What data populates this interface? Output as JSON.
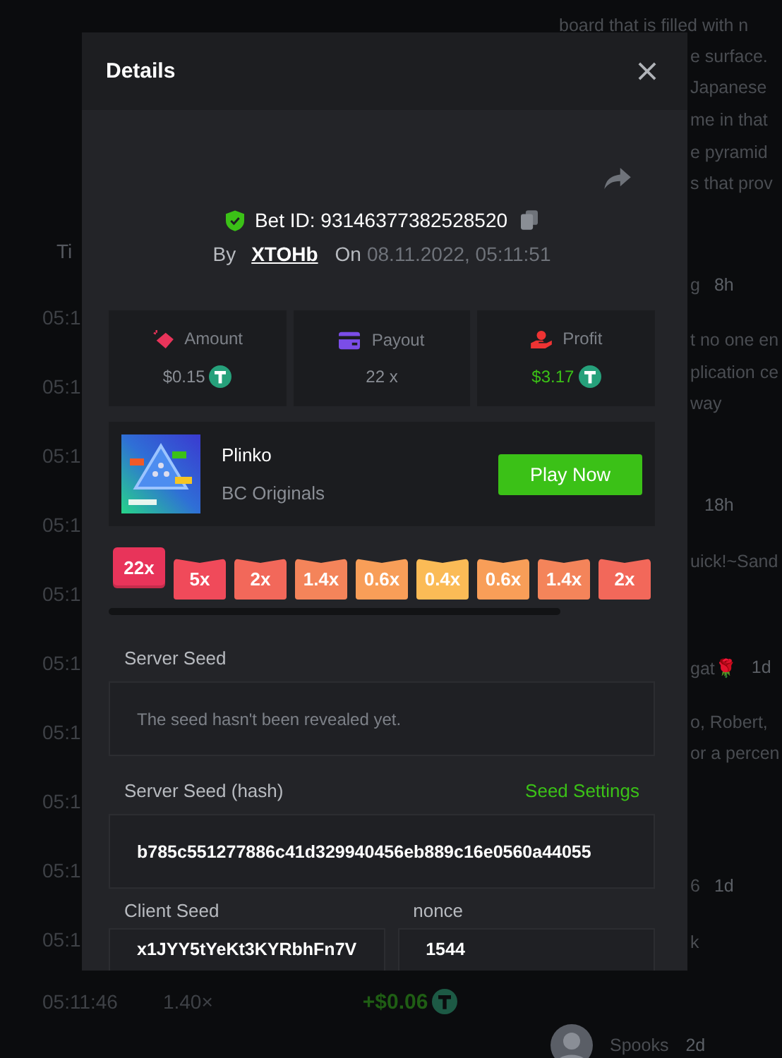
{
  "background": {
    "table": {
      "header": "Ti",
      "rows": [
        {
          "time": "05:1"
        },
        {
          "time": "05:1"
        },
        {
          "time": "05:1"
        },
        {
          "time": "05:1"
        },
        {
          "time": "05:1"
        },
        {
          "time": "05:1"
        },
        {
          "time": "05:1"
        },
        {
          "time": "05:1"
        },
        {
          "time": "05:1"
        },
        {
          "time": "05:1"
        }
      ],
      "last_row": {
        "time": "05:11:46",
        "payout": "1.40×",
        "profit": "+$0.06"
      }
    },
    "chat": {
      "lines": [
        {
          "kind": "full",
          "text": "board that is filled with n"
        },
        {
          "kind": "cut",
          "text": "e surface."
        },
        {
          "kind": "cut",
          "text": "Japanese"
        },
        {
          "kind": "cut",
          "text": "me in that"
        },
        {
          "kind": "cut",
          "text": "e pyramid"
        },
        {
          "kind": "cut",
          "text": "s that prov"
        },
        {
          "kind": "meta",
          "text": "g",
          "age": "8h"
        },
        {
          "kind": "cut",
          "text": "t no one en"
        },
        {
          "kind": "cut",
          "text": "plication ce"
        },
        {
          "kind": "cut",
          "text": "way"
        },
        {
          "kind": "meta",
          "age": "18h"
        },
        {
          "kind": "cut",
          "text": "uick!~Sand"
        },
        {
          "kind": "meta",
          "text": "gat🌹",
          "age": "1d"
        },
        {
          "kind": "cut",
          "text": "o, Robert,"
        },
        {
          "kind": "cut",
          "text": "or a percen"
        },
        {
          "kind": "meta",
          "text": "6",
          "age": "1d"
        },
        {
          "kind": "cut",
          "text": "k"
        }
      ],
      "user": {
        "name": "Spooks",
        "age": "2d"
      }
    }
  },
  "modal": {
    "title": "Details",
    "bet": {
      "id_label": "Bet ID: 93146377382528520",
      "by_label": "By",
      "user": "XTOHb",
      "on_label": "On",
      "date": "08.11.2022, 05:11:51"
    },
    "stats": [
      {
        "kind": "amount",
        "label": "Amount",
        "value": "$0.15",
        "coin": true,
        "positive": false
      },
      {
        "kind": "payout",
        "label": "Payout",
        "value": "22 x",
        "coin": false,
        "positive": false
      },
      {
        "kind": "profit",
        "label": "Profit",
        "value": "$3.17",
        "coin": true,
        "positive": true
      }
    ],
    "game": {
      "name": "Plinko",
      "provider": "BC Originals",
      "button": "Play Now"
    },
    "multipliers": [
      {
        "label": "22x",
        "color": "#e8345a",
        "selected": true
      },
      {
        "label": "5x",
        "color": "#f04a5a",
        "selected": false
      },
      {
        "label": "2x",
        "color": "#f2685a",
        "selected": false
      },
      {
        "label": "1.4x",
        "color": "#f4845a",
        "selected": false
      },
      {
        "label": "0.6x",
        "color": "#f89e58",
        "selected": false
      },
      {
        "label": "0.4x",
        "color": "#fbbb56",
        "selected": false
      },
      {
        "label": "0.6x",
        "color": "#f89e58",
        "selected": false
      },
      {
        "label": "1.4x",
        "color": "#f4845a",
        "selected": false
      },
      {
        "label": "2x",
        "color": "#f2685a",
        "selected": false
      }
    ],
    "server_seed": {
      "label": "Server Seed",
      "note": "The seed hasn't been revealed yet."
    },
    "server_seed_hash": {
      "label": "Server Seed (hash)",
      "link": "Seed Settings",
      "value": "b785c551277886c41d329940456eb889c16e0560a44055"
    },
    "client_seed": {
      "label": "Client Seed",
      "value": "x1JYY5tYeKt3KYRbhFn7V"
    },
    "nonce": {
      "label": "nonce",
      "value": "1544"
    }
  }
}
